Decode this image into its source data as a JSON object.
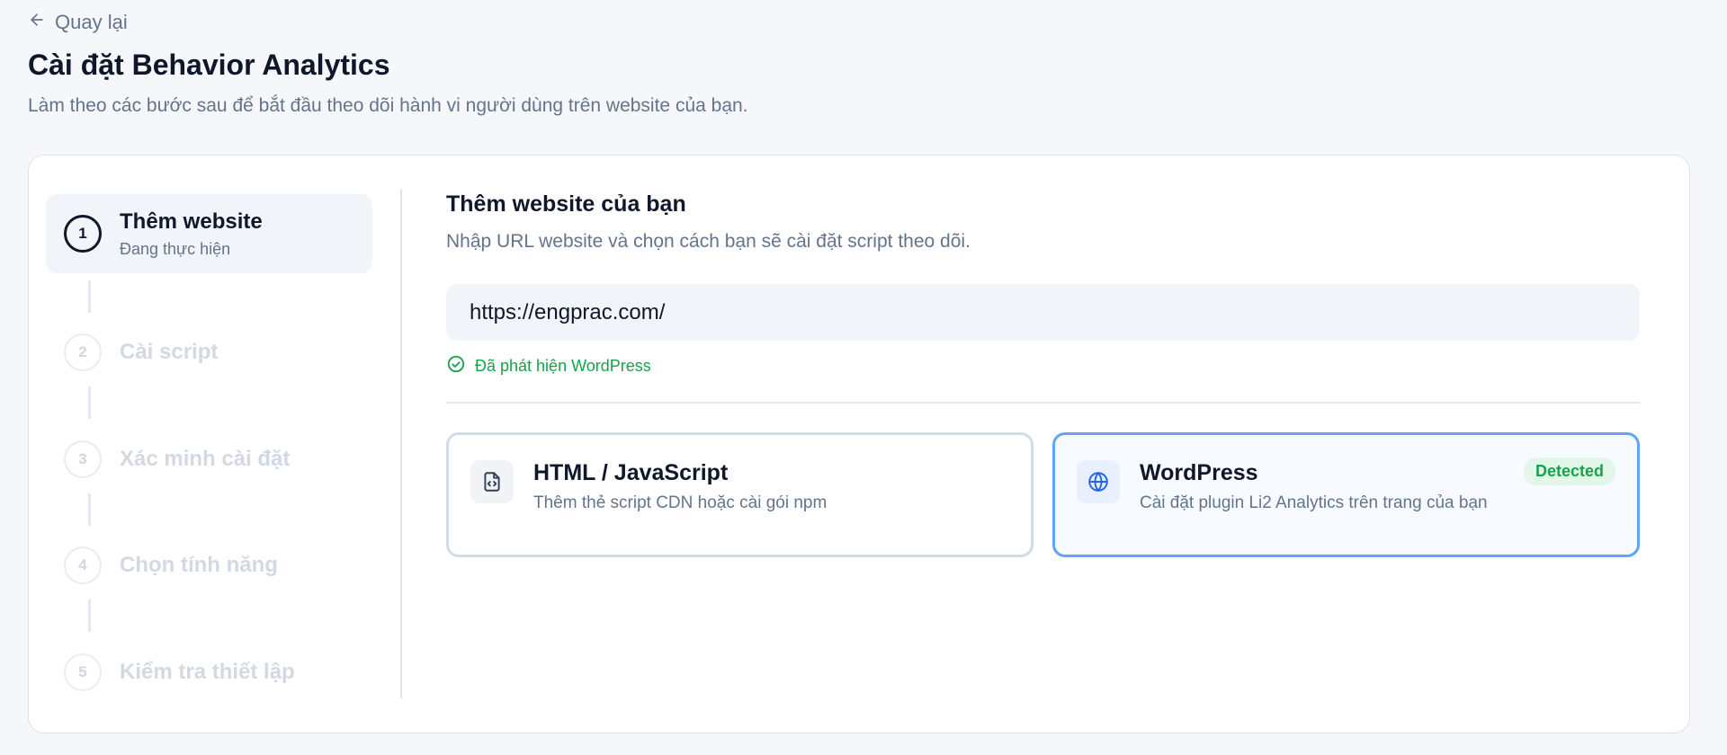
{
  "header": {
    "back_label": "Quay lại",
    "title": "Cài đặt Behavior Analytics",
    "subtitle": "Làm theo các bước sau để bắt đầu theo dõi hành vi người dùng trên website của bạn."
  },
  "stepper": {
    "steps": [
      {
        "number": "1",
        "label": "Thêm website",
        "status": "Đang thực hiện",
        "state": "active"
      },
      {
        "number": "2",
        "label": "Cài script",
        "state": "pending"
      },
      {
        "number": "3",
        "label": "Xác minh cài đặt",
        "state": "pending"
      },
      {
        "number": "4",
        "label": "Chọn tính năng",
        "state": "pending"
      },
      {
        "number": "5",
        "label": "Kiểm tra thiết lập",
        "state": "pending"
      }
    ]
  },
  "main": {
    "title": "Thêm website của bạn",
    "description": "Nhập URL website và chọn cách bạn sẽ cài đặt script theo dõi.",
    "url_value": "https://engprac.com/",
    "detect_note": "Đã phát hiện WordPress",
    "options": [
      {
        "icon": "file-code-icon",
        "title": "HTML / JavaScript",
        "description": "Thêm thẻ script CDN hoặc cài gói npm",
        "selected": false
      },
      {
        "icon": "globe-icon",
        "title": "WordPress",
        "description": "Cài đặt plugin Li2 Analytics trên trang của bạn",
        "badge": "Detected",
        "selected": true
      }
    ]
  },
  "colors": {
    "accent": "#60a5fa",
    "success": "#16a34a",
    "text_primary": "#0f172a",
    "text_muted": "#64748b"
  }
}
